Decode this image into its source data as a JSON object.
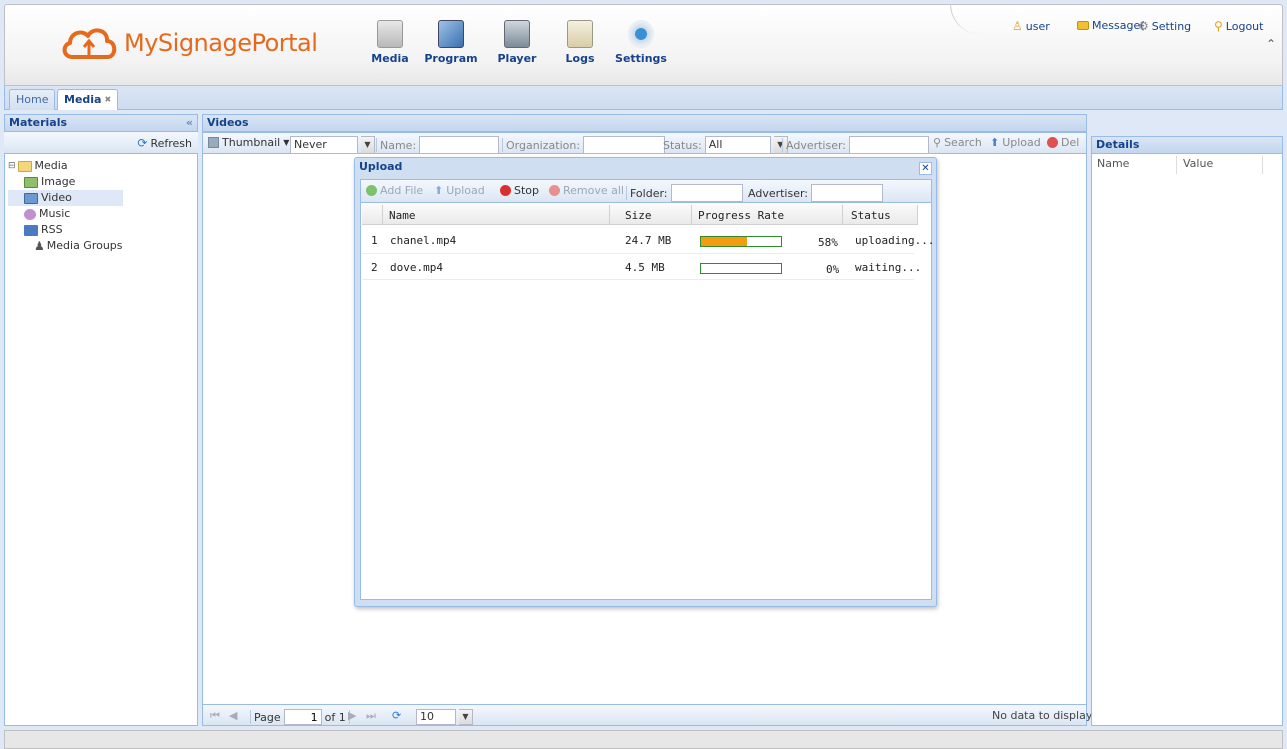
{
  "header": {
    "brand_part1": "MySignage",
    "brand_part2": "Portal",
    "nav": [
      {
        "label": "Media",
        "icon": "media-icon"
      },
      {
        "label": "Program",
        "icon": "program-icon"
      },
      {
        "label": "Player",
        "icon": "player-icon"
      },
      {
        "label": "Logs",
        "icon": "logs-icon"
      },
      {
        "label": "Settings",
        "icon": "settings-icon"
      }
    ],
    "user_label": "user",
    "message_label": "Message(",
    "setting_label": "Setting",
    "logout_label": "Logout"
  },
  "tabs": [
    {
      "label": "Home",
      "active": false
    },
    {
      "label": "Media",
      "active": true
    }
  ],
  "left_panel": {
    "title": "Materials",
    "refresh_label": "Refresh",
    "tree": {
      "root": "Media",
      "children": [
        "Image",
        "Video",
        "Music",
        "RSS",
        "Media Groups"
      ],
      "selected": "Video"
    }
  },
  "main_panel": {
    "title": "Videos",
    "toolbar": {
      "view_label": "Thumbnail",
      "never_value": "Never",
      "name_label": "Name:",
      "organization_label": "Organization:",
      "status_label": "Status:",
      "status_value": "All",
      "advertiser_label": "Advertiser:",
      "search_label": "Search",
      "upload_label": "Upload",
      "delete_label": "Del"
    },
    "pager": {
      "page_label": "Page",
      "page_value": "1",
      "of_label": "of 1",
      "page_size": "10",
      "empty_text": "No data to display"
    }
  },
  "details_panel": {
    "title": "Details",
    "columns": [
      "Name",
      "Value"
    ]
  },
  "upload_dialog": {
    "title": "Upload",
    "toolbar": {
      "add_file": "Add File",
      "upload": "Upload",
      "stop": "Stop",
      "remove_all": "Remove all",
      "folder_label": "Folder:",
      "advertiser_label": "Advertiser:"
    },
    "columns": [
      "Name",
      "Size",
      "Progress Rate",
      "Status"
    ],
    "rows": [
      {
        "index": "1",
        "name": "chanel.mp4",
        "size": "24.7 MB",
        "progress": 0.58,
        "progress_text": "58%",
        "status": "uploading..."
      },
      {
        "index": "2",
        "name": "dove.mp4",
        "size": "4.5 MB",
        "progress": 0.0,
        "progress_text": "0%",
        "status": "waiting..."
      }
    ]
  },
  "colors": {
    "accent": "#15428b",
    "brand": "#e56a1d",
    "progress_fill": "#f39c12",
    "progress_border": "#2e8b2e"
  }
}
